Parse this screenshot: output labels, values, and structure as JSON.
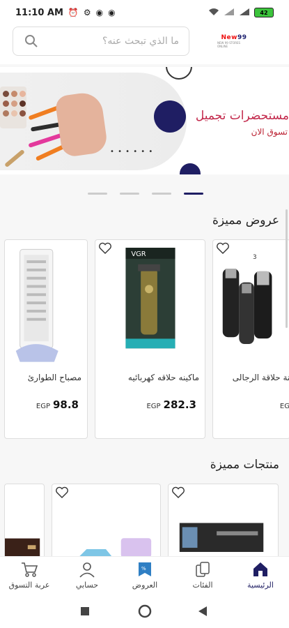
{
  "status": {
    "time": "11:10 AM",
    "battery": "42"
  },
  "header": {
    "search_placeholder": "ما الذي تبحث عنه؟",
    "logo_text": "New",
    "logo_num": "99",
    "logo_sub": "NEW 99 STORES ONLINE"
  },
  "banner": {
    "title": "مستحضرات تجميل",
    "subtitle": "تسوق الان"
  },
  "carousel": {
    "count": 4,
    "active_index": 3
  },
  "featured_offers": {
    "title": "عروض مميزة",
    "items": [
      {
        "name": "مصباح الطوارئ",
        "currency": "EGP",
        "price": "98.8"
      },
      {
        "name": "ماكينه حلاقه كهربائيه",
        "currency": "EGP",
        "price": "282.3"
      },
      {
        "name": "ماكينة حلاقة الرجالى",
        "currency": "EG",
        "price": ""
      }
    ]
  },
  "featured_products": {
    "title": "منتجات مميزة"
  },
  "bottom_nav": {
    "items": [
      {
        "label": "عربة التسوق",
        "icon": "cart-icon"
      },
      {
        "label": "حسابي",
        "icon": "user-icon"
      },
      {
        "label": "العروض",
        "icon": "offers-icon"
      },
      {
        "label": "الفئات",
        "icon": "categories-icon"
      },
      {
        "label": "الرئيسية",
        "icon": "home-icon",
        "active": true
      }
    ]
  },
  "colors": {
    "brand": "#1f1e63",
    "accent": "#c2274a"
  }
}
